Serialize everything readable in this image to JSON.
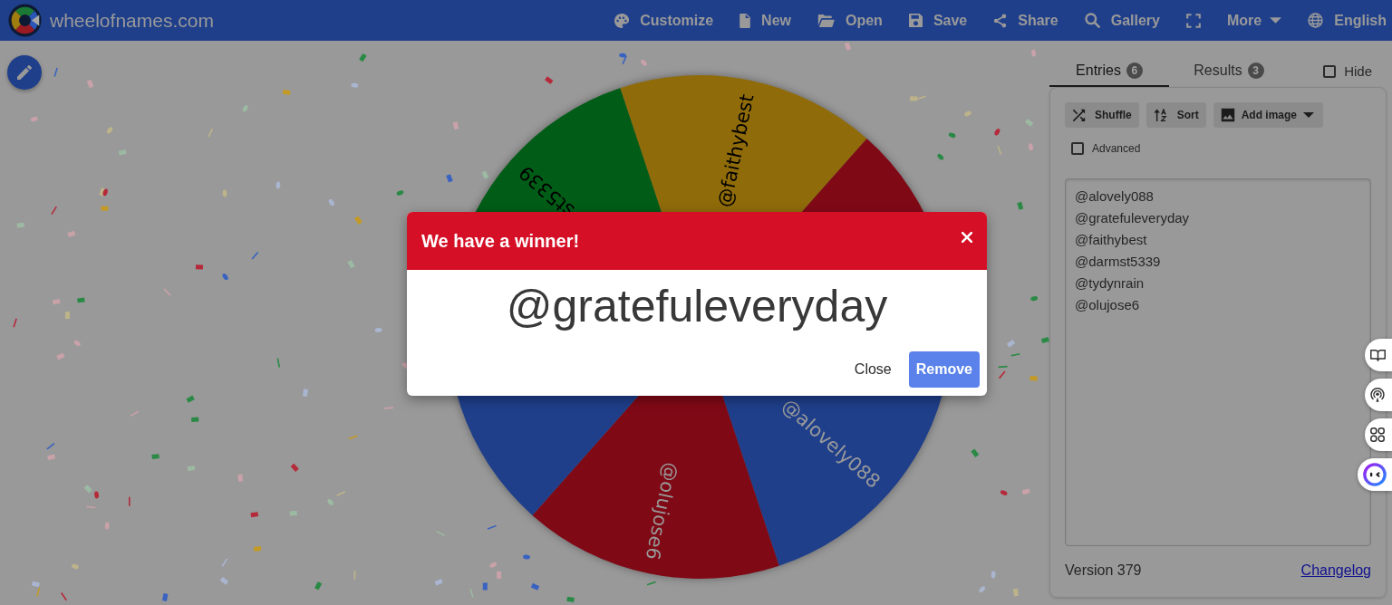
{
  "navbar": {
    "site_name": "wheelofnames.com",
    "items": [
      {
        "kind": "link",
        "label": "Customize"
      },
      {
        "kind": "link",
        "label": "New"
      },
      {
        "kind": "link",
        "label": "Open"
      },
      {
        "kind": "link",
        "label": "Save"
      },
      {
        "kind": "link",
        "label": "Share"
      },
      {
        "kind": "link",
        "label": "Gallery"
      },
      {
        "kind": "icon"
      },
      {
        "kind": "dropdown",
        "label": "More"
      },
      {
        "kind": "link",
        "label": "English"
      }
    ]
  },
  "wheel": {
    "slices": [
      {
        "label": "@faithybest",
        "color": "#8f6b0a"
      },
      {
        "color": "#800916"
      },
      {
        "label": "@alovely088",
        "color": "#1f3f8b"
      },
      {
        "label": "@olujose6",
        "color": "#800916"
      },
      {
        "color": "#1f3f8b"
      },
      {
        "label": "st5339",
        "color": "#005c16"
      }
    ]
  },
  "panel": {
    "tabs": [
      {
        "label": "Entries",
        "count": "6",
        "selected": true
      },
      {
        "label": "Results",
        "count": "3",
        "selected": false
      }
    ],
    "hide": {
      "label": "Hide",
      "checked": false
    },
    "toolbar": [
      {
        "kind": "button",
        "label": "Shuffle"
      },
      {
        "kind": "button",
        "label": "Sort"
      },
      {
        "kind": "dropdown",
        "label": "Add image"
      }
    ],
    "advanced": {
      "label": "Advanced",
      "checked": false
    },
    "entries": [
      "@alovely088",
      "@gratefuleveryday",
      "@faithybest",
      "@darmst5339",
      "@tydynrain",
      "@olujose6"
    ],
    "version": "Version 379",
    "changelog": "Changelog"
  },
  "dialog": {
    "title": "We have a winner!",
    "winner": "@gratefuleveryday",
    "buttons": [
      {
        "kind": "text",
        "label": "Close"
      },
      {
        "kind": "primary",
        "label": "Remove"
      }
    ]
  }
}
